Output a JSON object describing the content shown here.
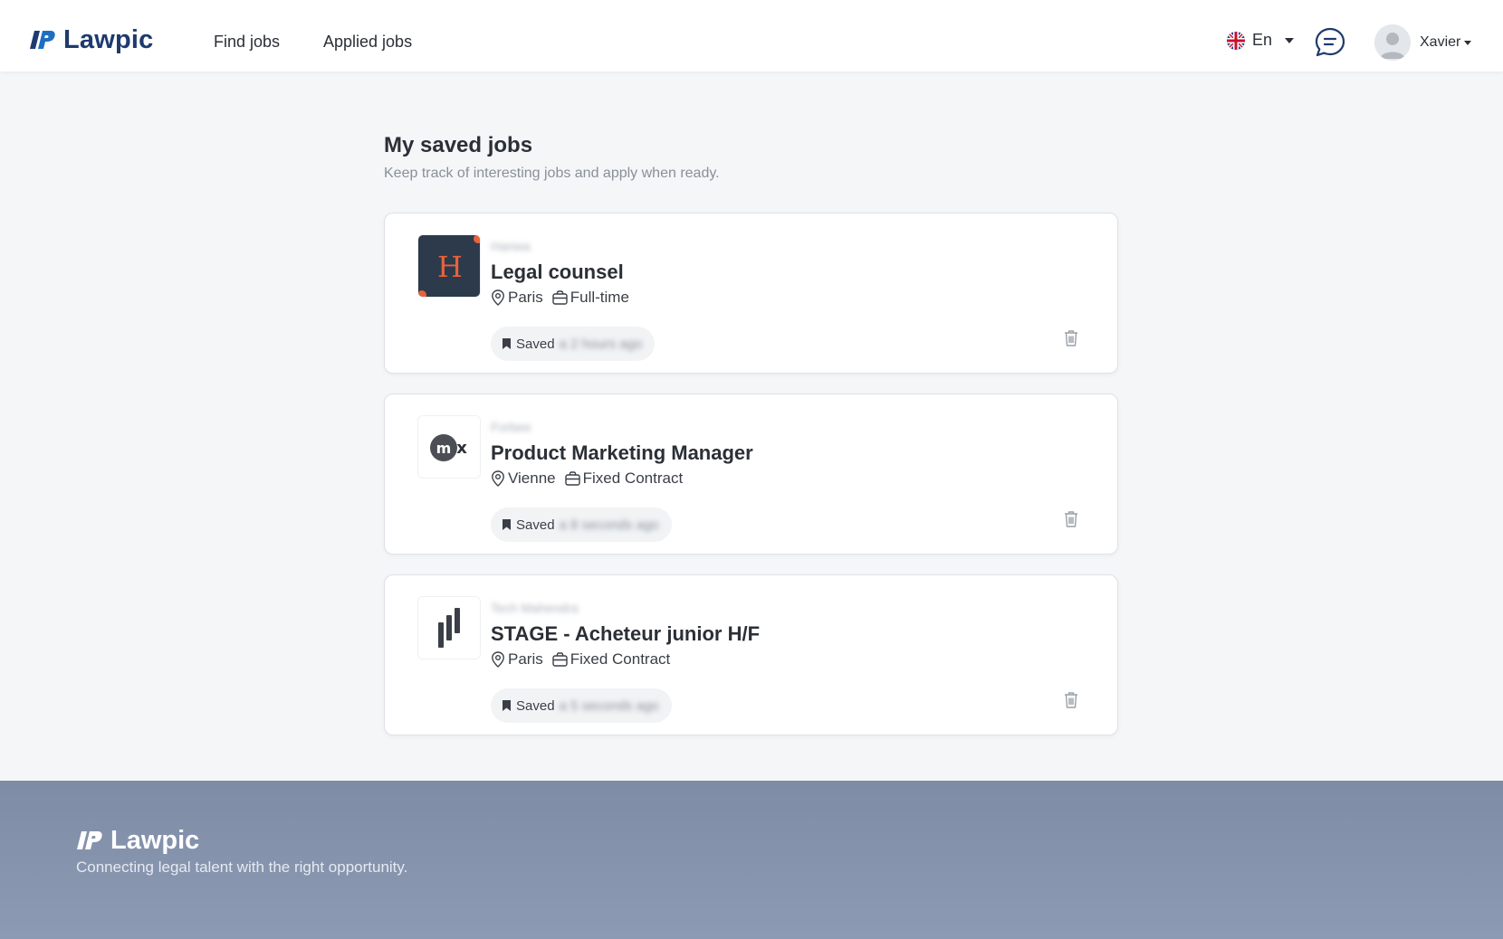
{
  "header": {
    "brand": "Lawpic",
    "nav": {
      "find_jobs": "Find jobs",
      "applied_jobs": "Applied jobs"
    },
    "language": "En",
    "user_name": "Xavier"
  },
  "main": {
    "title": "My saved jobs",
    "subtitle": "Keep track of interesting jobs and apply when ready.",
    "jobs": [
      {
        "company": "Hanwa",
        "logo_letter": "H",
        "title": "Legal counsel",
        "location": "Paris",
        "contract": "Full-time",
        "saved_label": "Saved",
        "saved_ago": "a 2 hours ago"
      },
      {
        "company": "Forbee",
        "logo_letter": "mx",
        "title": "Product Marketing Manager",
        "location": "Vienne",
        "contract": "Fixed Contract",
        "saved_label": "Saved",
        "saved_ago": "a 8 seconds ago"
      },
      {
        "company": "Tech Mahendra",
        "title": "STAGE - Acheteur junior H/F",
        "location": "Paris",
        "contract": "Fixed Contract",
        "saved_label": "Saved",
        "saved_ago": "a 5 seconds ago"
      }
    ]
  },
  "footer": {
    "brand": "Lawpic",
    "tagline": "Connecting legal talent with the right opportunity."
  },
  "colors": {
    "brand": "#1e3a6e",
    "accent_orange": "#e8623a",
    "footer_bg": "#8593ad"
  }
}
